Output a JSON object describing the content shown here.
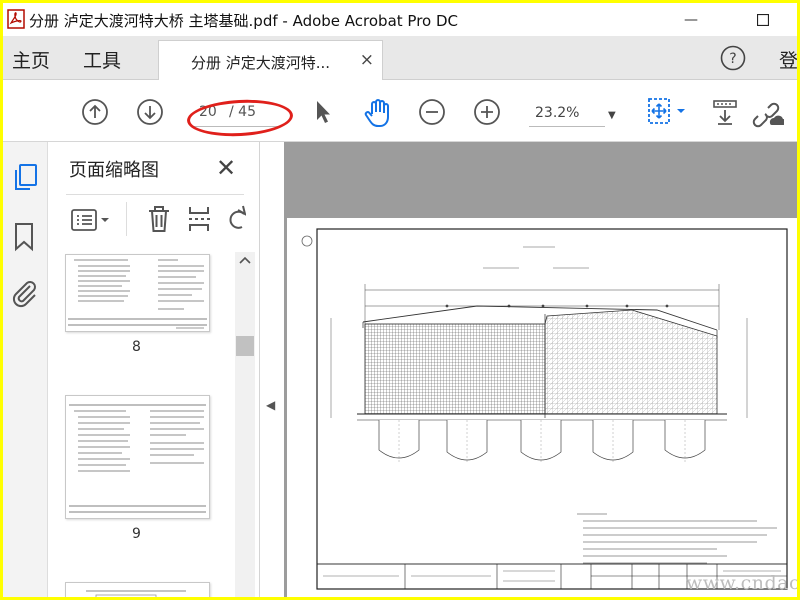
{
  "window": {
    "title": "分册 泸定大渡河特大桥 主塔基础.pdf - Adobe Acrobat Pro DC",
    "minimize_glyph": "—",
    "maximize_glyph": "☐"
  },
  "menu": {
    "home": "主页",
    "tools": "工具",
    "login": "登"
  },
  "tab": {
    "label": "分册 泸定大渡河特...",
    "close": "×"
  },
  "help": {
    "label": "?"
  },
  "toolbar": {
    "page_current": "20",
    "page_total": "/ 45",
    "zoom": "23.2%"
  },
  "panel": {
    "title": "页面缩略图",
    "close": "✕",
    "thumbnails": [
      {
        "label": "8"
      },
      {
        "label": "9"
      }
    ]
  },
  "watermark": "www.cndao.com",
  "colors": {
    "accent_blue": "#1473e6",
    "annotation_red": "#e0201b",
    "frame_yellow": "#ffff00"
  },
  "icons": [
    "acrobat-app-icon",
    "page-up-icon",
    "page-down-icon",
    "select-arrow-icon",
    "hand-tool-icon",
    "zoom-out-icon",
    "zoom-in-icon",
    "fit-page-icon",
    "scroll-mode-icon",
    "share-link-icon",
    "thumbnails-icon",
    "bookmark-icon",
    "attachment-icon"
  ]
}
